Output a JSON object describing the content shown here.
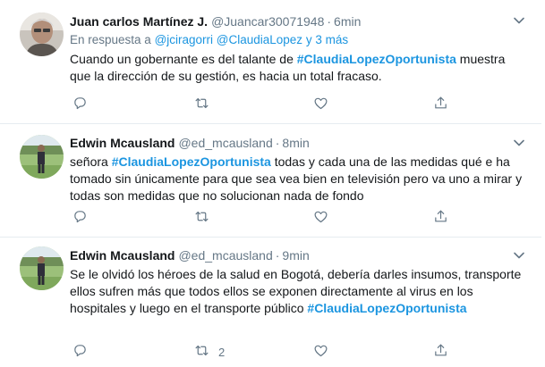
{
  "tweets": [
    {
      "name": "Juan carlos Martínez J.",
      "handle": "@Juancar30071948",
      "separator": "·",
      "time": "6min",
      "reply_prefix": "En respuesta a",
      "reply_mentions": "@jciragorri @ClaudiaLopez",
      "reply_suffix": "y 3 más",
      "text_before": "Cuando un gobernante es del talante de ",
      "hashtag": "#ClaudiaLopezOportunista",
      "text_after": " muestra que la dirección de su gestión, es hacia un total fracaso.",
      "counts": {
        "reply": "",
        "retweet": "",
        "like": ""
      }
    },
    {
      "name": "Edwin Mcausland",
      "handle": "@ed_mcausland",
      "separator": "·",
      "time": "8min",
      "text_before": "señora ",
      "hashtag": "#ClaudiaLopezOportunista",
      "text_after": " todas y cada una de las medidas qué e ha tomado sin únicamente para que sea vea bien en televisión pero va uno a mirar y todas son medidas que no solucionan nada de fondo",
      "counts": {
        "reply": "",
        "retweet": "",
        "like": ""
      }
    },
    {
      "name": "Edwin Mcausland",
      "handle": "@ed_mcausland",
      "separator": "·",
      "time": "9min",
      "text_before": "Se le olvidó los héroes de la salud en Bogotá, debería darles insumos, transporte ellos sufren más que todos ellos se exponen directamente al virus en los hospitales y luego en el transporte público ",
      "hashtag": "#ClaudiaLopezOportunista",
      "text_after": "",
      "counts": {
        "reply": "",
        "retweet": "2",
        "like": ""
      }
    }
  ],
  "icons": {
    "reply": "reply-icon",
    "retweet": "retweet-icon",
    "like": "like-icon",
    "share": "share-icon",
    "caret": "chevron-down-icon"
  },
  "colors": {
    "accent": "#1b95e0",
    "muted": "#657786",
    "text": "#14171a",
    "divider": "#e6ecf0"
  }
}
